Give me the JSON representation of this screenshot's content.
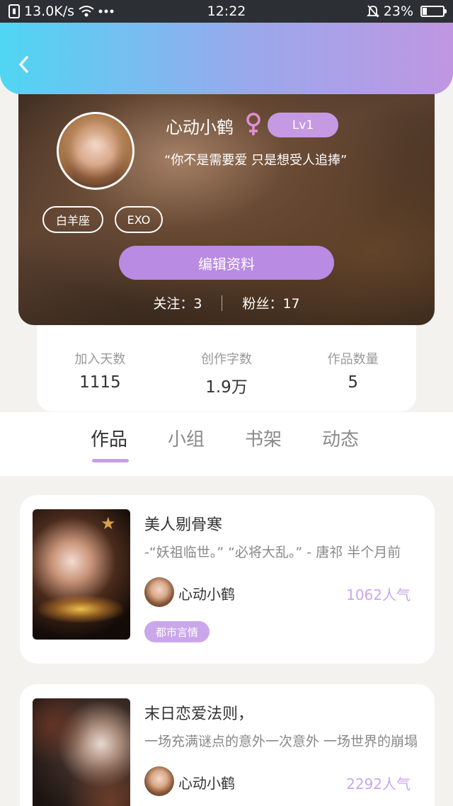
{
  "status_bar": {
    "net_speed": "13.0K/s",
    "time": "12:22",
    "battery": "23%",
    "battery_level": 0.23
  },
  "profile": {
    "nickname": "心动小鹤",
    "level": "Lv1",
    "signature": "“你不是需要爱 只是想受人追捧”",
    "tags": [
      "白羊座",
      "EXO"
    ],
    "edit_label": "编辑资料",
    "following_label": "关注：",
    "following_count": "3",
    "followers_label": "粉丝：",
    "followers_count": "17"
  },
  "stats": [
    {
      "label": "加入天数",
      "value": "1115"
    },
    {
      "label": "创作字数",
      "value": "1.9万"
    },
    {
      "label": "作品数量",
      "value": "5"
    }
  ],
  "tabs": [
    {
      "label": "作品",
      "active": true
    },
    {
      "label": "小组",
      "active": false
    },
    {
      "label": "书架",
      "active": false
    },
    {
      "label": "动态",
      "active": false
    }
  ],
  "works": [
    {
      "title": "美人剔骨寒",
      "description": "-“妖祖临世。” “必将大乱。” - 唐祁 半个月前",
      "author": "心动小鹤",
      "popularity": "1062人气",
      "genre": "都市言情"
    },
    {
      "title": "末日恋爱法则，",
      "description": "一场充满谜点的意外一次意外 一场世界的崩塌",
      "author": "心动小鹤",
      "popularity": "2292人气"
    }
  ],
  "colors": {
    "accent": "#c59ae3",
    "header_start": "#4fd6f3",
    "header_end": "#c096e2"
  }
}
